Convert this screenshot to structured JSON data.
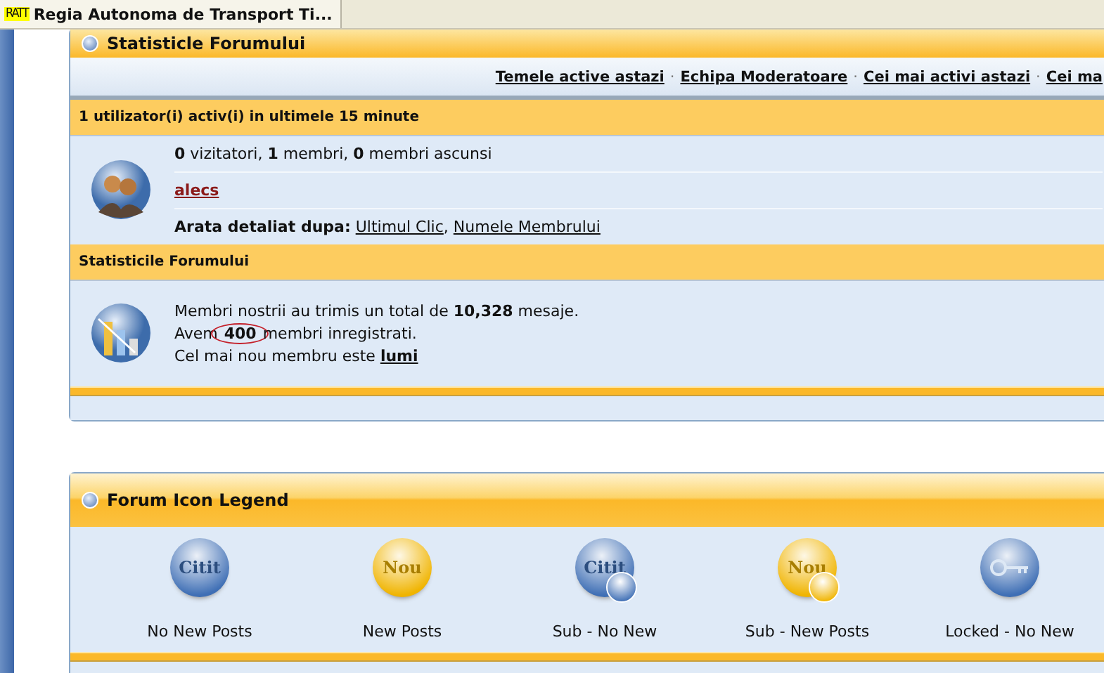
{
  "browser_tab": {
    "logo": "RATT",
    "title": "Regia Autonoma de Transport Ti..."
  },
  "stats_panel": {
    "title": "Statisticle Forumului",
    "links": [
      "Temele active astazi",
      "Echipa Moderatoare",
      "Cei mai activi astazi",
      "Cei ma"
    ],
    "link_separator": "·",
    "sort_separator": ",",
    "online_header": "1 utilizator(i) activ(i) in ultimele 15 minute",
    "online_counts": "**0** vizitatori, **1** membri, **0** membri ascunsi",
    "online_user": "alecs",
    "sort_label": "Arata detaliat dupa:",
    "sort_links": [
      "Ultimul Clic",
      "Numele Membrului"
    ],
    "stats_header": "Statisticile Forumului",
    "stats_lines": [
      {
        "text": "Membri nostrii au trimis un total de **10,328** mesaje.",
        "circled": false
      },
      {
        "text": "Avem **400** membri inregistrati.",
        "circled": true
      }
    ],
    "newest_label": "Cel mai nou membru este",
    "newest_member": "lumi"
  },
  "legend_panel": {
    "title": "Forum Icon Legend",
    "items": [
      {
        "kind": "plain",
        "color": "#3f6fb5",
        "icon_text": "Citit",
        "label": "No New Posts"
      },
      {
        "kind": "plain",
        "color": "#f0b400",
        "icon_text": "Nou",
        "label": "New Posts"
      },
      {
        "kind": "sub",
        "color": "#3f6fb5",
        "icon_text": "Citit",
        "label": "Sub - No New"
      },
      {
        "kind": "sub",
        "color": "#f0b400",
        "icon_text": "Nou",
        "label": "Sub - New Posts"
      },
      {
        "kind": "locked",
        "color": "#3f6fb5",
        "label": "Locked - No New"
      }
    ]
  }
}
